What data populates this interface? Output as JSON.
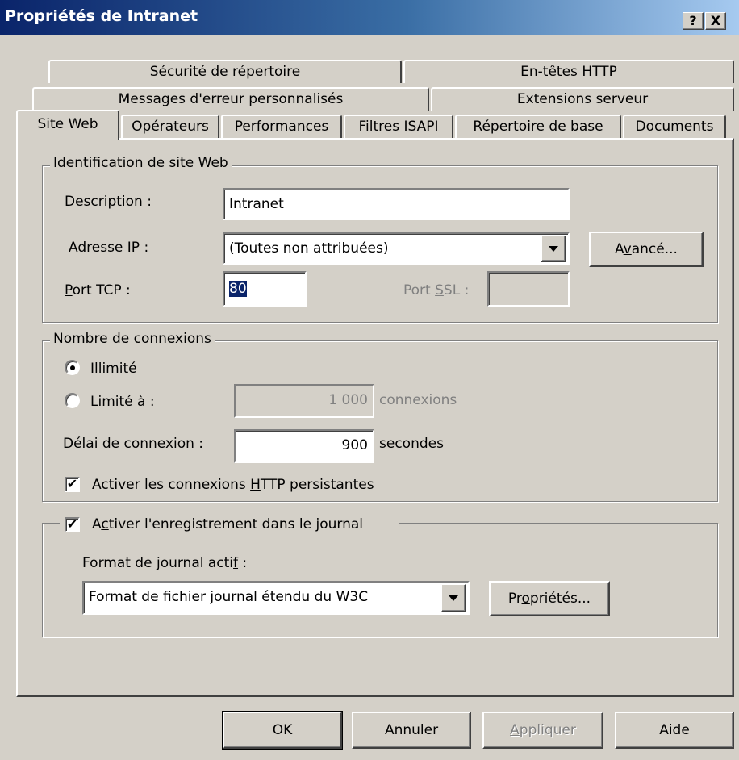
{
  "window": {
    "title": "Propriétés de Intranet",
    "help_btn": "?",
    "close_btn": "X"
  },
  "tabs": {
    "row1": [
      "Sécurité de répertoire",
      "En-têtes HTTP"
    ],
    "row2": [
      "Messages d'erreur personnalisés",
      "Extensions serveur"
    ],
    "row3": [
      "Site Web",
      "Opérateurs",
      "Performances",
      "Filtres ISAPI",
      "Répertoire de base",
      "Documents"
    ],
    "active": "Site Web"
  },
  "identification": {
    "legend": "Identification de site Web",
    "description": {
      "label_key": "D",
      "label_rest": "escription :",
      "value": "Intranet"
    },
    "ip": {
      "label_pre": "Ad",
      "label_key": "r",
      "label_rest": "esse IP :",
      "value": "(Toutes non attribuées)"
    },
    "advanced_button": {
      "pre": "A",
      "key": "v",
      "rest": "ancé..."
    },
    "tcp": {
      "label_key": "P",
      "label_rest": "ort TCP :",
      "value": "80"
    },
    "ssl": {
      "label_pre": "Port ",
      "label_key": "S",
      "label_rest": "SL :",
      "value": ""
    }
  },
  "connections": {
    "legend": "Nombre de connexions",
    "unlimited": {
      "key": "I",
      "rest": "llimité",
      "selected": true
    },
    "limited": {
      "key": "L",
      "rest": "imité à :",
      "selected": false,
      "value": "1 000",
      "unit": "connexions"
    },
    "timeout": {
      "label_pre": "Délai de conne",
      "label_key": "x",
      "label_rest": "ion :",
      "value": "900",
      "unit": "secondes"
    },
    "keepalive": {
      "pre": "Activer les connexions ",
      "key": "H",
      "rest": "TTP persistantes",
      "checked": true
    }
  },
  "logging": {
    "enable": {
      "pre": "A",
      "key": "c",
      "rest": "tiver l'enregistrement dans le journal",
      "checked": true
    },
    "format_label": {
      "pre": "Format de journal acti",
      "key": "f",
      "rest": " :"
    },
    "format_value": "Format de fichier journal étendu du W3C",
    "properties_button": {
      "pre": "Pr",
      "key": "o",
      "rest": "priétés..."
    }
  },
  "footer": {
    "ok": "OK",
    "cancel": "Annuler",
    "apply": {
      "key": "A",
      "rest": "ppliquer",
      "enabled": false
    },
    "help": "Aide"
  }
}
